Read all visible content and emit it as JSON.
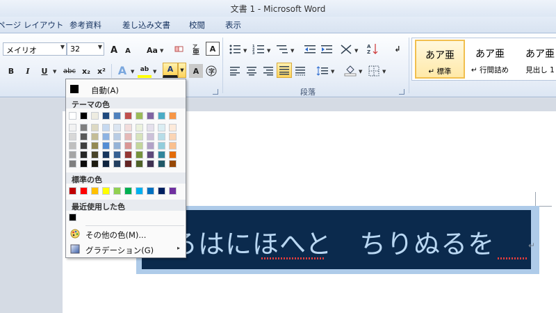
{
  "window": {
    "title": "文書 1 - Microsoft Word"
  },
  "tabs": [
    "ページ レイアウト",
    "参考資料",
    "差し込み文書",
    "校閲",
    "表示"
  ],
  "font": {
    "name": "メイリオ",
    "size": "32"
  },
  "buttons": {
    "grow": "A",
    "shrink": "A",
    "case": "Aa",
    "bold": "B",
    "italic": "I",
    "underline": "U",
    "strike": "abc",
    "subscript": "x₂",
    "superscript": "x²",
    "font_color": "A",
    "char_shade": "A",
    "highlight": "ab"
  },
  "groups": {
    "paragraph": "段落"
  },
  "styles": [
    {
      "sample": "あア亜",
      "name": "↵ 標準"
    },
    {
      "sample": "あア亜",
      "name": "↵ 行間詰め"
    },
    {
      "sample": "あア亜",
      "name": "見出し 1"
    }
  ],
  "document": {
    "text": "ろはにほへと　ちりぬるを",
    "paragraph_mark": "↵"
  },
  "color_menu": {
    "automatic": "自動(A)",
    "theme_header": "テーマの色",
    "standard_header": "標準の色",
    "recent_header": "最近使用した色",
    "more_colors": "その他の色(M)...",
    "gradient": "グラデーション(G)",
    "gradient_arrow": "▸",
    "theme_colors": [
      "#ffffff",
      "#000000",
      "#eeece1",
      "#1f497d",
      "#4f81bd",
      "#c0504d",
      "#9bbb59",
      "#8064a2",
      "#4bacc6",
      "#f79646"
    ],
    "theme_shades": [
      [
        "#f2f2f2",
        "#7f7f7f",
        "#ddd9c3",
        "#c6d9f0",
        "#dbe5f1",
        "#f2dcdb",
        "#ebf1dd",
        "#e5e0ec",
        "#dbeef3",
        "#fdeada"
      ],
      [
        "#d8d8d8",
        "#595959",
        "#c4bd97",
        "#8db3e2",
        "#b8cce4",
        "#e5b9b7",
        "#d7e3bc",
        "#ccc1d9",
        "#b7dde8",
        "#fbd5b5"
      ],
      [
        "#bfbfbf",
        "#3f3f3f",
        "#938953",
        "#548dd4",
        "#95b3d7",
        "#d99694",
        "#c3d69b",
        "#b2a2c7",
        "#92cddc",
        "#fac08f"
      ],
      [
        "#a5a5a5",
        "#262626",
        "#494429",
        "#17365d",
        "#366092",
        "#953734",
        "#76923c",
        "#5f497a",
        "#31859b",
        "#e36c09"
      ],
      [
        "#7f7f7f",
        "#0c0c0c",
        "#1d1b10",
        "#0f243e",
        "#244061",
        "#632423",
        "#4f6128",
        "#3f3151",
        "#205867",
        "#974806"
      ]
    ],
    "standard_colors": [
      "#c00000",
      "#ff0000",
      "#ffc000",
      "#ffff00",
      "#92d050",
      "#00b050",
      "#00b0f0",
      "#0070c0",
      "#002060",
      "#7030a0"
    ],
    "recent_colors": [
      "#000000"
    ]
  },
  "colors": {
    "selection_bg": "#0b2a4d",
    "selection_text": "#b9d7f2",
    "accent": "#ffd35a"
  }
}
